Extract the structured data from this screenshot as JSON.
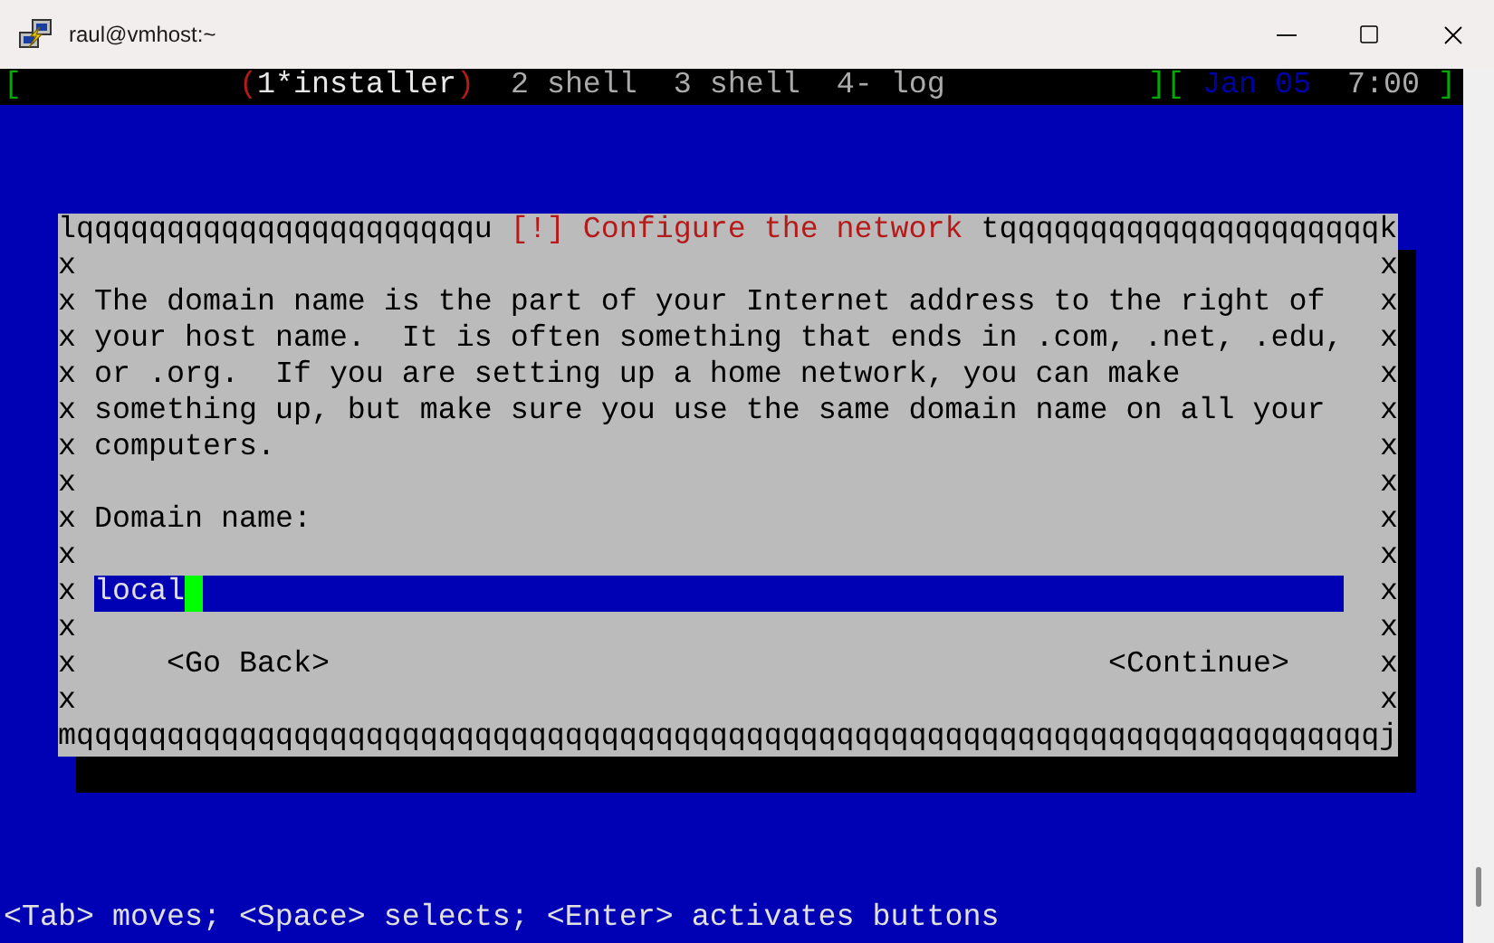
{
  "window": {
    "title": "raul@vmhost:~"
  },
  "top_bar": {
    "open_bracket": "[",
    "windows": [
      {
        "label": "1*installer",
        "prefix": "(",
        "suffix": ")",
        "selected": true
      },
      {
        "label": "2 shell",
        "selected": false
      },
      {
        "label": "3 shell",
        "selected": false
      },
      {
        "label": "4- log",
        "selected": false
      }
    ],
    "mid_bracket": "][",
    "date": "Jan 05",
    "time": "7:00",
    "close_bracket": "]"
  },
  "dialog": {
    "top_left": "lqqqqqqqqqqqqqqqqqqqqqqu",
    "title": "[!] Configure the network",
    "top_right": "tqqqqqqqqqqqqqqqqqqqqqk",
    "border_left": [
      "x",
      "x",
      "x",
      "x",
      "x",
      "x",
      "x",
      "x",
      "x",
      "x",
      "x",
      "x",
      "x"
    ],
    "border_right": [
      "x",
      "x",
      "x",
      "x",
      "x",
      "x",
      "x",
      "x",
      "x",
      "x",
      "x",
      "x",
      "x"
    ],
    "paragraph": [
      "The domain name is the part of your Internet address to the right of",
      "your host name.  It is often something that ends in .com, .net, .edu,",
      "or .org.  If you are setting up a home network, you can make",
      "something up, but make sure you use the same domain name on all your",
      "computers."
    ],
    "label": "Domain name:",
    "input": {
      "value": "local"
    },
    "buttons": [
      "<Go Back>",
      "<Continue>"
    ],
    "bottom": "mqqqqqqqqqqqqqqqqqqqqqqqqqqqqqqqqqqqqqqqqqqqqqqqqqqqqqqqqqqqqqqqqqqqqqqqqj"
  },
  "help": "<Tab> moves; <Space> selects; <Enter> activates buttons"
}
